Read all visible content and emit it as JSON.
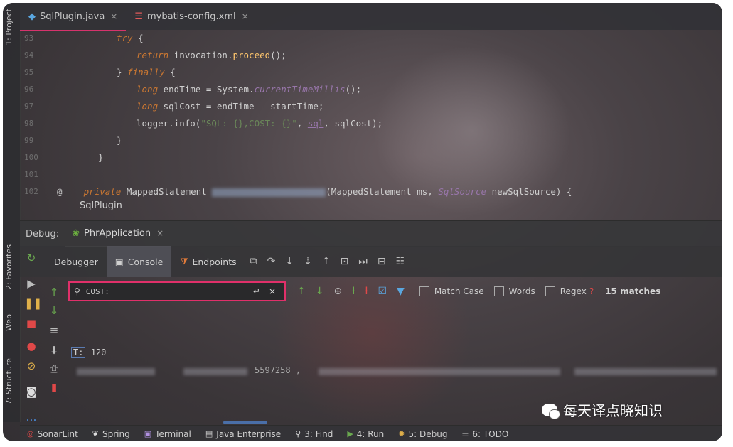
{
  "editor": {
    "tabs": [
      {
        "label": "SqlPlugin.java",
        "close": "×"
      },
      {
        "label": "mybatis-config.xml",
        "close": "×"
      }
    ],
    "lines": [
      {
        "n": "93"
      },
      {
        "n": "94"
      },
      {
        "n": "95"
      },
      {
        "n": "96"
      },
      {
        "n": "97"
      },
      {
        "n": "98"
      },
      {
        "n": "99"
      },
      {
        "n": "100"
      },
      {
        "n": "101"
      },
      {
        "n": "102"
      }
    ],
    "code": {
      "l93": {
        "kw": "try",
        "rest": " {"
      },
      "l94": {
        "kw": "return",
        "a": " invocation.",
        "fn": "proceed",
        "b": "();"
      },
      "l95": {
        "a": "} ",
        "kw": "finally",
        "b": " {"
      },
      "l96": {
        "kw": "long",
        "a": " endTime = System.",
        "st": "currentTimeMillis",
        "b": "();"
      },
      "l97": {
        "kw": "long",
        "a": " sqlCost = endTime - startTime;"
      },
      "l98": {
        "a": "logger.info(",
        "str": "\"SQL: {},COST: {}\"",
        "b": ", ",
        "fld": "sql",
        "c": ", sqlCost);"
      },
      "l99": {
        "a": "}"
      },
      "l100": {
        "a": "}"
      },
      "l102": {
        "at": "@",
        "kw": "private",
        "a": " MappedStatement ",
        "b": "(MappedStatement ms, ",
        "st": "SqlSource",
        "c": " newSqlSource) {"
      }
    },
    "breadcrumb": "SqlPlugin"
  },
  "debug": {
    "label": "Debug:",
    "run_config": "PhrApplication",
    "run_close": "×"
  },
  "toolbar": {
    "tabs": [
      "Debugger",
      "Console",
      "Endpoints"
    ]
  },
  "search": {
    "value": "COST:",
    "enter_glyph": "↵",
    "clear_glyph": "×",
    "options": [
      "Match Case",
      "Words",
      "Regex"
    ],
    "help": "?",
    "matches": "15 matches"
  },
  "console": {
    "line1_prefix": "T:",
    "line1_value": "120",
    "line2_fragment": "5597258",
    "line2_comma": ","
  },
  "left_strip": {
    "tabs": [
      "1: Project",
      "2: Favorites",
      "Web",
      "7: Structure"
    ]
  },
  "statusbar": {
    "items": [
      {
        "label": "SonarLint"
      },
      {
        "label": "Spring"
      },
      {
        "label": "Terminal"
      },
      {
        "label": "Java Enterprise"
      },
      {
        "label": "3: Find"
      },
      {
        "label": "4: Run"
      },
      {
        "label": "5: Debug"
      },
      {
        "label": "6: TODO"
      }
    ]
  },
  "watermark": {
    "text": "每天译点晓知识"
  },
  "colors": {
    "highlight": "#e0306a",
    "keyword": "#cc7832",
    "method": "#ffc66d",
    "string": "#6a8759",
    "field": "#9876aa"
  }
}
